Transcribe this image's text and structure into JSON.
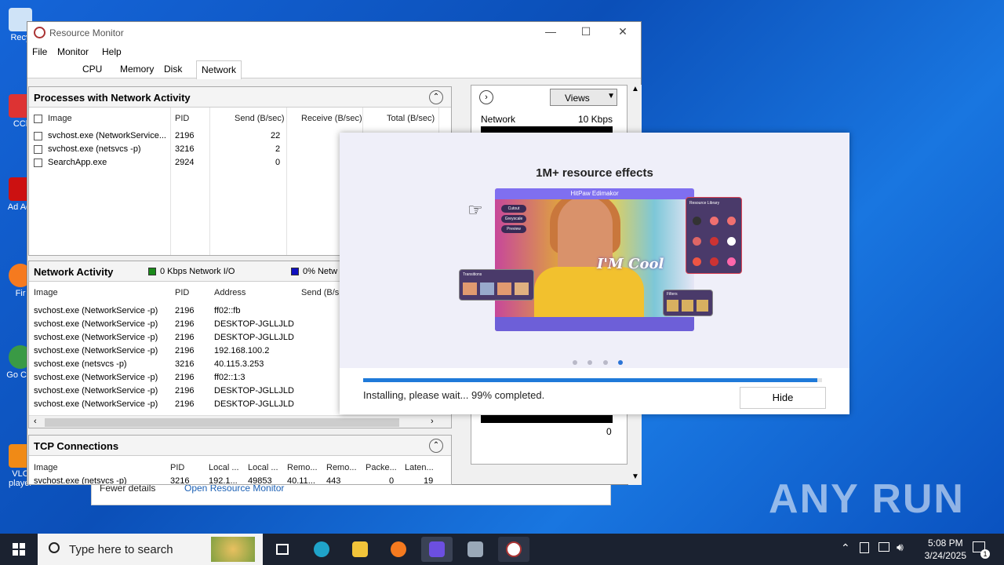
{
  "desktop": {
    "icons": [
      "Recy",
      "CCl",
      "Ad Acr",
      "Fir",
      "Go Chr",
      "VLC player"
    ],
    "watermark": "ANY RUN"
  },
  "behind": {
    "fewer_details": "Fewer details",
    "open_rm": "Open Resource Monitor"
  },
  "rm": {
    "title": "Resource Monitor",
    "menu": [
      "File",
      "Monitor",
      "Help"
    ],
    "tabs": [
      "CPU",
      "Memory",
      "Disk",
      "Network"
    ],
    "processes": {
      "title": "Processes with Network Activity",
      "headers": [
        "Image",
        "PID",
        "Send (B/sec)",
        "Receive (B/sec)",
        "Total (B/sec)"
      ],
      "rows": [
        {
          "image": "svchost.exe (NetworkService...",
          "pid": "2196",
          "send": "22"
        },
        {
          "image": "svchost.exe (netsvcs -p)",
          "pid": "3216",
          "send": "2"
        },
        {
          "image": "SearchApp.exe",
          "pid": "2924",
          "send": "0"
        }
      ]
    },
    "activity": {
      "title": "Network Activity",
      "legend1": "0 Kbps Network I/O",
      "legend2": "0% Netw",
      "headers": [
        "Image",
        "PID",
        "Address",
        "Send (B/s"
      ],
      "rows": [
        {
          "image": "svchost.exe (NetworkService -p)",
          "pid": "2196",
          "addr": "ff02::fb"
        },
        {
          "image": "svchost.exe (NetworkService -p)",
          "pid": "2196",
          "addr": "DESKTOP-JGLLJLD"
        },
        {
          "image": "svchost.exe (NetworkService -p)",
          "pid": "2196",
          "addr": "DESKTOP-JGLLJLD"
        },
        {
          "image": "svchost.exe (NetworkService -p)",
          "pid": "2196",
          "addr": "192.168.100.2"
        },
        {
          "image": "svchost.exe (netsvcs -p)",
          "pid": "3216",
          "addr": "40.115.3.253"
        },
        {
          "image": "svchost.exe (NetworkService -p)",
          "pid": "2196",
          "addr": "ff02::1:3"
        },
        {
          "image": "svchost.exe (NetworkService -p)",
          "pid": "2196",
          "addr": "DESKTOP-JGLLJLD"
        },
        {
          "image": "svchost.exe (NetworkService -p)",
          "pid": "2196",
          "addr": "DESKTOP-JGLLJLD"
        }
      ]
    },
    "tcp": {
      "title": "TCP Connections",
      "headers": [
        "Image",
        "PID",
        "Local ...",
        "Local ...",
        "Remo...",
        "Remo...",
        "Packe...",
        "Laten..."
      ],
      "row": {
        "image": "svchost.exe (netsvcs -p)",
        "pid": "3216",
        "l1": "192.1...",
        "l2": "49853",
        "r1": "40.11...",
        "r2": "443",
        "p": "0",
        "lat": "19"
      }
    },
    "right": {
      "views": "Views",
      "graph_label": "Network",
      "graph_scale": "10 Kbps",
      "graph_zero": "0"
    }
  },
  "installer": {
    "heading": "1M+ resource effects",
    "art_title": "HitPaw Edimakor",
    "art_text": "I'M Cool",
    "menu_items": [
      "Cutout",
      "Greyscale",
      "Preview"
    ],
    "lib_title": "Resource Library",
    "trans_title": "Transitions",
    "filt_title": "Filters",
    "dots_active": 4,
    "progress": 99,
    "status": "Installing, please wait... 99% completed.",
    "hide_label": "Hide"
  },
  "taskbar": {
    "search_placeholder": "Type here to search",
    "time": "5:08 PM",
    "date": "3/24/2025",
    "notif_count": "1"
  }
}
